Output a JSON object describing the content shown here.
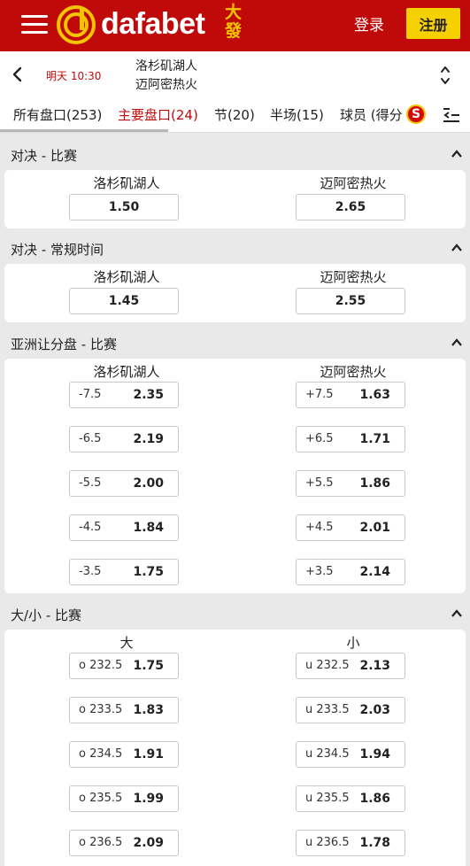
{
  "header": {
    "brand": "dafabet",
    "brand_cn": "大發",
    "login_label": "登录",
    "register_label": "注册"
  },
  "match": {
    "time": "明天 10:30",
    "home": "洛杉矶湖人",
    "away": "迈阿密热火"
  },
  "tabs": [
    {
      "label": "所有盘口(253)",
      "active": false
    },
    {
      "label": "主要盘口(24)",
      "active": true
    },
    {
      "label": "节(20)",
      "active": false
    },
    {
      "label": "半场(15)",
      "active": false
    },
    {
      "label": "球员 (得分",
      "active": false
    }
  ],
  "tab_icons": {
    "special": "S",
    "sort": "sort-icon"
  },
  "sections": {
    "moneyline_match": {
      "title": "对决 - 比赛",
      "left_label": "洛杉矶湖人",
      "right_label": "迈阿密热火",
      "left_price": "1.50",
      "right_price": "2.65"
    },
    "moneyline_regular": {
      "title": "对决 - 常规时间",
      "left_label": "洛杉矶湖人",
      "right_label": "迈阿密热火",
      "left_price": "1.45",
      "right_price": "2.55"
    },
    "handicap": {
      "title": "亚洲让分盘 - 比赛",
      "left_label": "洛杉矶湖人",
      "right_label": "迈阿密热火",
      "rows": [
        {
          "left_line": "-7.5",
          "left_price": "2.35",
          "right_line": "+7.5",
          "right_price": "1.63"
        },
        {
          "left_line": "-6.5",
          "left_price": "2.19",
          "right_line": "+6.5",
          "right_price": "1.71"
        },
        {
          "left_line": "-5.5",
          "left_price": "2.00",
          "right_line": "+5.5",
          "right_price": "1.86"
        },
        {
          "left_line": "-4.5",
          "left_price": "1.84",
          "right_line": "+4.5",
          "right_price": "2.01"
        },
        {
          "left_line": "-3.5",
          "left_price": "1.75",
          "right_line": "+3.5",
          "right_price": "2.14"
        }
      ]
    },
    "totals": {
      "title": "大/小 - 比赛",
      "left_label": "大",
      "right_label": "小",
      "rows": [
        {
          "left_line": "o 232.5",
          "left_price": "1.75",
          "right_line": "u 232.5",
          "right_price": "2.13"
        },
        {
          "left_line": "o 233.5",
          "left_price": "1.83",
          "right_line": "u 233.5",
          "right_price": "2.03"
        },
        {
          "left_line": "o 234.5",
          "left_price": "1.91",
          "right_line": "u 234.5",
          "right_price": "1.94"
        },
        {
          "left_line": "o 235.5",
          "left_price": "1.99",
          "right_line": "u 235.5",
          "right_price": "1.86"
        },
        {
          "left_line": "o 236.5",
          "left_price": "2.09",
          "right_line": "u 236.5",
          "right_price": "1.78"
        }
      ]
    }
  },
  "colors": {
    "brand_red": "#c00a0a",
    "accent_yellow": "#f7d000",
    "page_bg": "#e9e9e9"
  }
}
